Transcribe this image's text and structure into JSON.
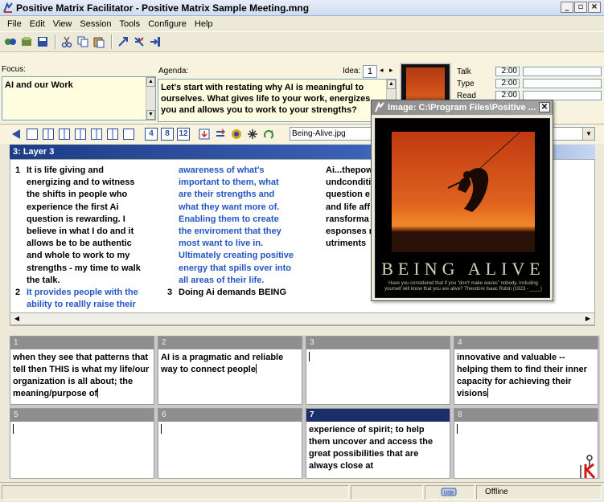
{
  "window": {
    "title": "Positive Matrix Facilitator - Positive Matrix Sample Meeting.mng",
    "buttons": [
      "_",
      "▫",
      "×"
    ]
  },
  "menu": [
    "File",
    "Edit",
    "View",
    "Session",
    "Tools",
    "Configure",
    "Help"
  ],
  "toolbar_icons": [
    "new-icon",
    "open-icon",
    "save-icon",
    "cut-icon",
    "copy-icon",
    "paste-icon",
    "expand-icon",
    "collapse-icon",
    "split-icon"
  ],
  "top": {
    "focus_label": "Focus:",
    "focus_text": "AI and our Work",
    "agenda_label": "Agenda:",
    "agenda_text": "Let's start with restating why AI is meaningful to ourselves.  What gives life to your work, energizes you and allows you to work to your strengths?",
    "idea_label": "Idea:",
    "idea_value": "1",
    "timers": [
      {
        "label": "Talk",
        "value": "2:00"
      },
      {
        "label": "Type",
        "value": "2:00"
      },
      {
        "label": "Read",
        "value": "2:00"
      }
    ]
  },
  "layoutbar": {
    "numbers": [
      "4",
      "8",
      "12"
    ],
    "image_select": "Being-Alive.jpg"
  },
  "layer": {
    "header": "3: Layer 3",
    "columns": [
      {
        "items": [
          {
            "num": "1",
            "text": "It is life giving and energizing and to witness the shifts in people who experience the first Ai question is rewarding.  I believe in what I do and it allows be to be authentic and whole to work to my strengths - my time to walk the talk.",
            "blue": false
          },
          {
            "num": "2",
            "text": "It provides people with the ability to reallly raise their",
            "blue": true
          }
        ]
      },
      {
        "items": [
          {
            "num": "",
            "text": "awareness  of what's important to them, what are their strengths and what they want more of. Enabling them to create the enviroment that they most want to live in. Ultimately creating positive energy that spills over into all areas of their life.",
            "blue": true
          },
          {
            "num": "3",
            "text": "Doing Ai demands BEING",
            "blue": false
          }
        ]
      },
      {
        "items": [
          {
            "num": "",
            "text": "Ai...thepow undconditi question e and life aff transforma responses nutriments",
            "blue": false
          }
        ]
      }
    ]
  },
  "cells": [
    {
      "n": "1",
      "text": "when they see that patterns that tell then THIS is what my life/our organization is all about; the meaning/purpose of",
      "active": false
    },
    {
      "n": "2",
      "text": "AI is a pragmatic and reliable way to connect people",
      "active": false
    },
    {
      "n": "3",
      "text": "",
      "active": false
    },
    {
      "n": "4",
      "text": "innovative and valuable -- helping them to find their inner capacity for achieving their visions",
      "active": false
    },
    {
      "n": "5",
      "text": "",
      "active": false
    },
    {
      "n": "6",
      "text": "",
      "active": false
    },
    {
      "n": "7",
      "text": "experience of spirit; to help them uncover and access the great possibilities that are always close at",
      "active": true
    },
    {
      "n": "8",
      "text": "",
      "active": false
    }
  ],
  "status": {
    "usb_label": "USB",
    "connection": "Offline"
  },
  "popup": {
    "title": "Image: C:\\Program Files\\Positive ...",
    "poster_title": "BEING ALIVE",
    "poster_caption": "Have you considered that if you \"don't make waves\" nobody, including yourself will know that you are alive? Theodore Isaac Rubin (1923 - ____)"
  },
  "colors": {
    "accent": "#1c3c86",
    "blue_text": "#2255c4",
    "focus_bg": "#fffde0"
  }
}
